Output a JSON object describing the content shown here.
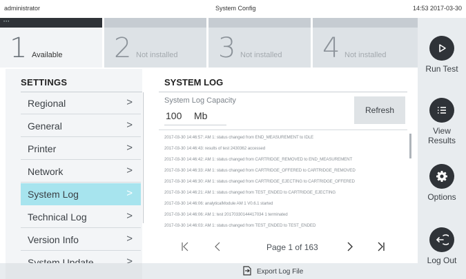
{
  "topbar": {
    "user": "administrator",
    "title": "System Config",
    "clock": "14:53 2017-03-30"
  },
  "modules": [
    {
      "num": "1",
      "label": "Available",
      "active": true
    },
    {
      "num": "2",
      "label": "Not installed",
      "active": false
    },
    {
      "num": "3",
      "label": "Not installed",
      "active": false
    },
    {
      "num": "4",
      "label": "Not installed",
      "active": false
    }
  ],
  "rail": {
    "run_test": "Run Test",
    "view_results": "View\nResults",
    "options": "Options",
    "log_out": "Log Out"
  },
  "settings": {
    "heading": "SETTINGS",
    "items": [
      {
        "label": "Regional"
      },
      {
        "label": "General"
      },
      {
        "label": "Printer"
      },
      {
        "label": "Network"
      },
      {
        "label": "System Log",
        "selected": true
      },
      {
        "label": "Technical Log"
      },
      {
        "label": "Version Info"
      },
      {
        "label": "System Update"
      }
    ]
  },
  "syslog": {
    "heading": "SYSTEM LOG",
    "capacity_label": "System Log Capacity",
    "capacity_value": "100",
    "capacity_unit": "Mb",
    "refresh_label": "Refresh",
    "entries": [
      "2017-03-30 14:46:57: AM 1: status changed from END_MEASUREMENT to IDLE",
      "2017-03-30 14:46:43: results of test 2430362 accessed",
      "2017-03-30 14:46:42: AM 1: status changed from CARTRIDGE_REMOVED to END_MEASUREMENT",
      "2017-03-30 14:46:33: AM 1: status changed from CARTRIDGE_OFFERED to CARTRIDGE_REMOVED",
      "2017-03-30 14:46:30: AM 1: status changed from CARTRIDGE_EJECTING to CARTRIDGE_OFFERED",
      "2017-03-30 14:46:21: AM 1: status changed from TEST_ENDED to CARTRIDGE_EJECTING",
      "2017-03-30 14:46:06: analyticalModule AM 1 V0.6.1 started",
      "2017-03-30 14:46:06: AM 1: test 20170330144417034 1 terminated",
      "2017-03-30 14:46:03: AM 1: status changed from TEST_ENDED to TEST_ENDED"
    ],
    "page_text": "Page 1 of 163"
  },
  "bottom": {
    "export_label": "Export Log File"
  },
  "colors": {
    "selected": "#a7e4ee",
    "dark": "#2f3338",
    "rail": "#e8ecef"
  },
  "icons": [
    "play-icon",
    "list-icon",
    "gear-icon",
    "logout-icon",
    "chevron-right-icon",
    "first-page-icon",
    "prev-page-icon",
    "next-page-icon",
    "last-page-icon",
    "export-icon"
  ]
}
